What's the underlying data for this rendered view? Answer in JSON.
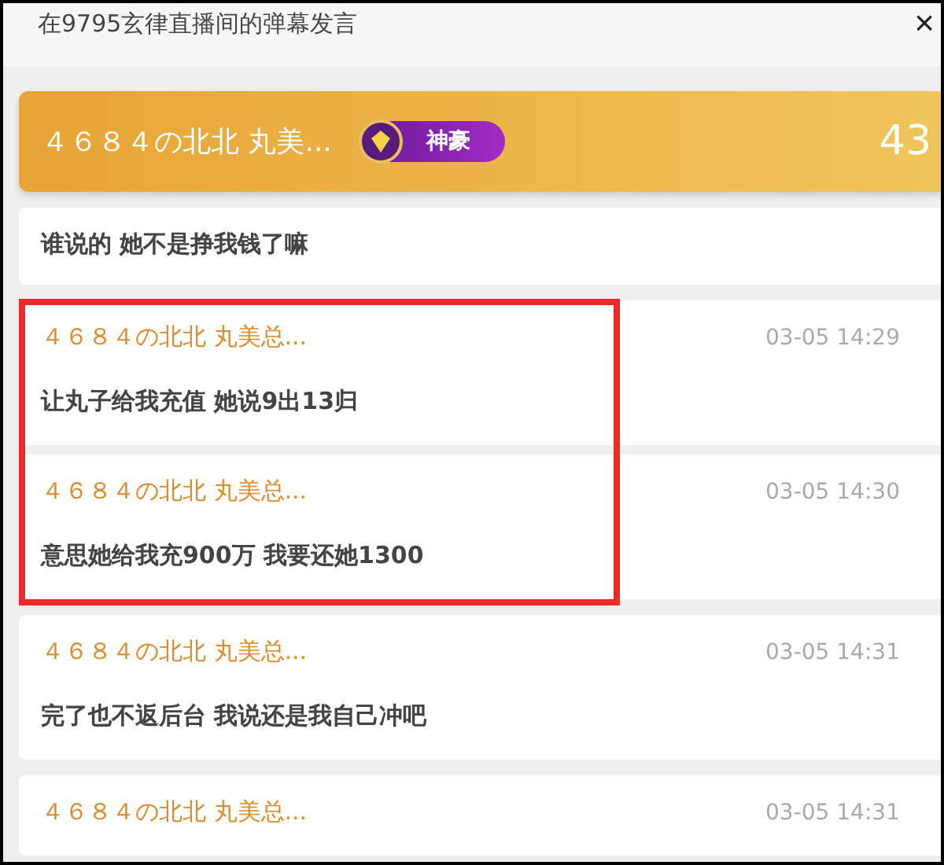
{
  "window": {
    "title": "在9795玄律直播间的弹幕发言",
    "close": "×"
  },
  "header": {
    "name": "４６８４の北北 丸美...",
    "badge": "神豪",
    "count": "43"
  },
  "first_message": {
    "text": "谁说的 她不是挣我钱了嘛"
  },
  "messages": [
    {
      "name": "４６８４の北北 丸美总...",
      "time": "03-05 14:29",
      "text": "让丸子给我充值 她说9出13归",
      "highlighted": true
    },
    {
      "name": "４６８４の北北 丸美总...",
      "time": "03-05 14:30",
      "text": "意思她给我充900万 我要还她1300",
      "highlighted": true
    },
    {
      "name": "４６８４の北北 丸美总...",
      "time": "03-05 14:31",
      "text": "完了也不返后台 我说还是我自己冲吧",
      "highlighted": false
    },
    {
      "name": "４６８４の北北 丸美总...",
      "time": "03-05 14:31",
      "highlighted": false
    }
  ]
}
